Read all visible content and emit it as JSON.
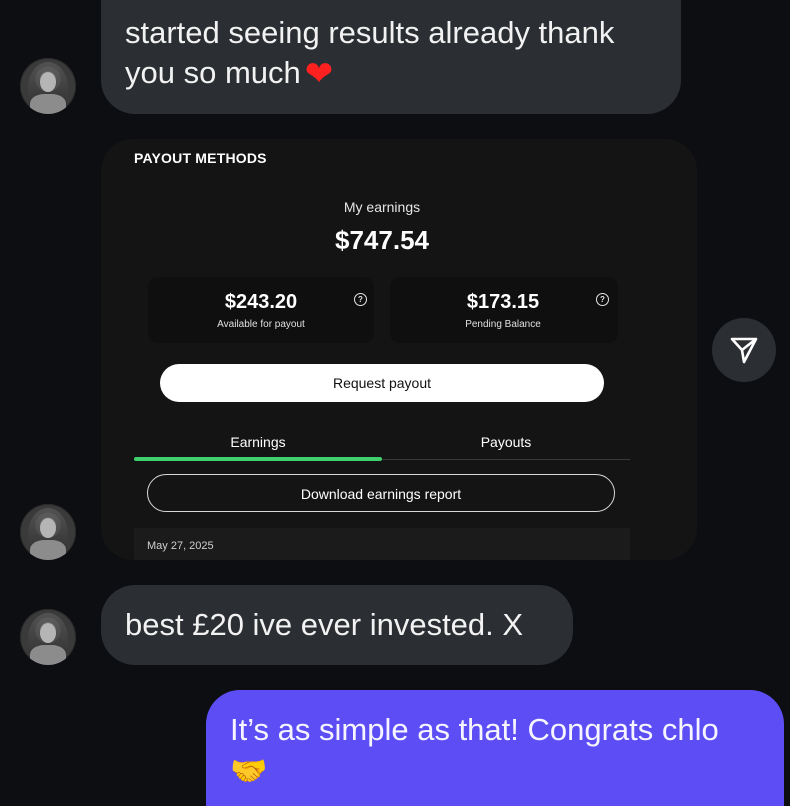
{
  "messages": {
    "first": {
      "text": "started seeing results already thank you so much",
      "emoji": "❤"
    },
    "second": {
      "text": "best £20 ive ever invested. X"
    },
    "reply": {
      "text": "It’s as simple as that! Congrats chlo",
      "emoji": "🤝"
    }
  },
  "payout_card": {
    "title": "PAYOUT METHODS",
    "earnings_label": "My earnings",
    "earnings_value": "$747.54",
    "available": {
      "value": "$243.20",
      "label": "Available for payout",
      "help": "?"
    },
    "pending": {
      "value": "$173.15",
      "label": "Pending Balance",
      "help": "?"
    },
    "request_button": "Request payout",
    "tabs": [
      "Earnings",
      "Payouts"
    ],
    "active_tab": "Earnings",
    "download_button": "Download earnings report",
    "date": "May 27, 2025"
  },
  "colors": {
    "background": "#0c0e12",
    "incoming_bubble": "#2b2e33",
    "outgoing_bubble": "#5c4ef4",
    "tab_accent": "#3fd06d"
  },
  "icons": {
    "share": "paper-plane-icon"
  }
}
